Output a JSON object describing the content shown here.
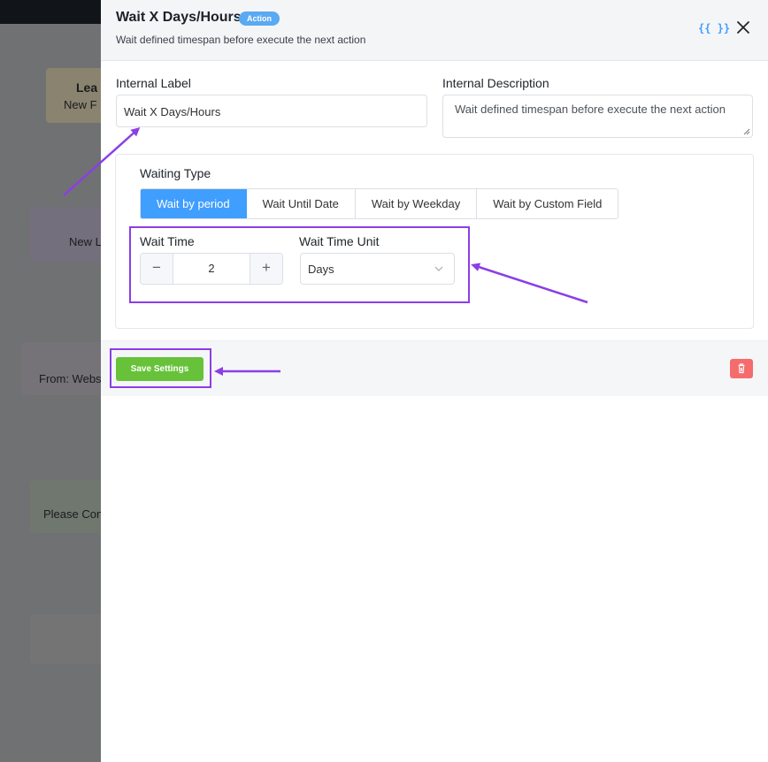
{
  "background": {
    "nodes": [
      {
        "line1": "Lea",
        "line2": "New F"
      },
      {
        "line1": "New L"
      },
      {
        "line1": "From: Webs"
      },
      {
        "line1": "Please Con"
      }
    ]
  },
  "header": {
    "title": "Wait X Days/Hours",
    "badge": "Action",
    "subtitle": "Wait defined timespan before execute the next action",
    "code_icon_text": "{{ }}"
  },
  "fields": {
    "internal_label": {
      "label": "Internal Label",
      "value": "Wait X Days/Hours"
    },
    "internal_description": {
      "label": "Internal Description",
      "value": "Wait defined timespan before execute the next action"
    }
  },
  "waiting": {
    "type_label": "Waiting Type",
    "tabs": [
      "Wait by period",
      "Wait Until Date",
      "Wait by Weekday",
      "Wait by Custom Field"
    ],
    "active_tab": "Wait by period",
    "wait_time_label": "Wait Time",
    "wait_time_value": "2",
    "wait_unit_label": "Wait Time Unit",
    "wait_unit_value": "Days",
    "minus": "−",
    "plus": "+"
  },
  "footer": {
    "save_label": "Save Settings"
  },
  "colors": {
    "accent": "#409eff",
    "save": "#67c23a",
    "delete": "#f56c6c",
    "annotation": "#8b3ee6"
  }
}
